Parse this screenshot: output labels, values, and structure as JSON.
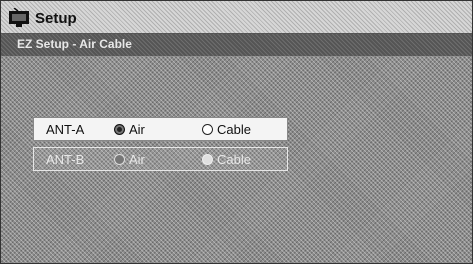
{
  "header": {
    "title": "Setup",
    "icon": "tv-setup-icon"
  },
  "subheader": {
    "title": "EZ Setup - Air Cable"
  },
  "antennas": [
    {
      "label": "ANT-A",
      "air_label": "Air",
      "cable_label": "Cable",
      "selected": "Air",
      "enabled": true
    },
    {
      "label": "ANT-B",
      "air_label": "Air",
      "cable_label": "Cable",
      "selected": "Air",
      "enabled": false
    }
  ]
}
